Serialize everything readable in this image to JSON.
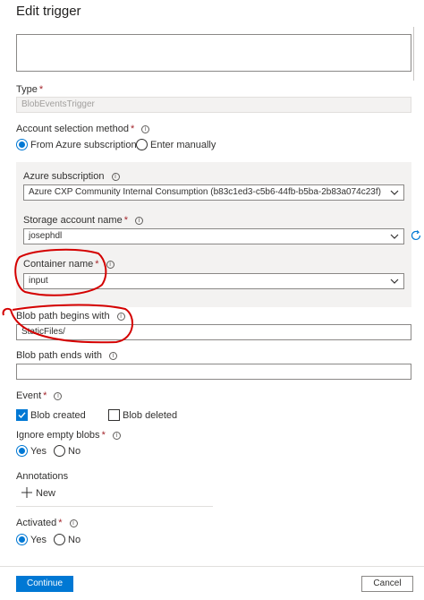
{
  "header": {
    "title": "Edit trigger"
  },
  "type": {
    "label": "Type",
    "required": "*",
    "value": "BlobEventsTrigger"
  },
  "account_selection": {
    "label": "Account selection method",
    "required": "*",
    "options": [
      "From Azure subscription",
      "Enter manually"
    ],
    "selected": "From Azure subscription"
  },
  "azure_subscription": {
    "label": "Azure subscription",
    "value": "Azure CXP Community Internal Consumption (b83c1ed3-c5b6-44fb-b5ba-2b83a074c23f)"
  },
  "storage_account": {
    "label": "Storage account name",
    "required": "*",
    "value": "josephdl"
  },
  "container": {
    "label": "Container name",
    "required": "*",
    "value": "input"
  },
  "blob_begins": {
    "label": "Blob path begins with",
    "value": "StaticFiles/"
  },
  "blob_ends": {
    "label": "Blob path ends with",
    "value": ""
  },
  "event": {
    "label": "Event",
    "required": "*",
    "options": [
      {
        "label": "Blob created",
        "checked": true
      },
      {
        "label": "Blob deleted",
        "checked": false
      }
    ]
  },
  "ignore_empty": {
    "label": "Ignore empty blobs",
    "required": "*",
    "options": [
      "Yes",
      "No"
    ],
    "selected": "Yes"
  },
  "annotations": {
    "label": "Annotations",
    "new_label": "New"
  },
  "activated": {
    "label": "Activated",
    "required": "*",
    "options": [
      "Yes",
      "No"
    ],
    "selected": "Yes"
  },
  "footer": {
    "continue_label": "Continue",
    "cancel_label": "Cancel"
  },
  "colors": {
    "accent": "#0078d4",
    "annotation_red": "#d40000",
    "required": "#a4262c"
  }
}
